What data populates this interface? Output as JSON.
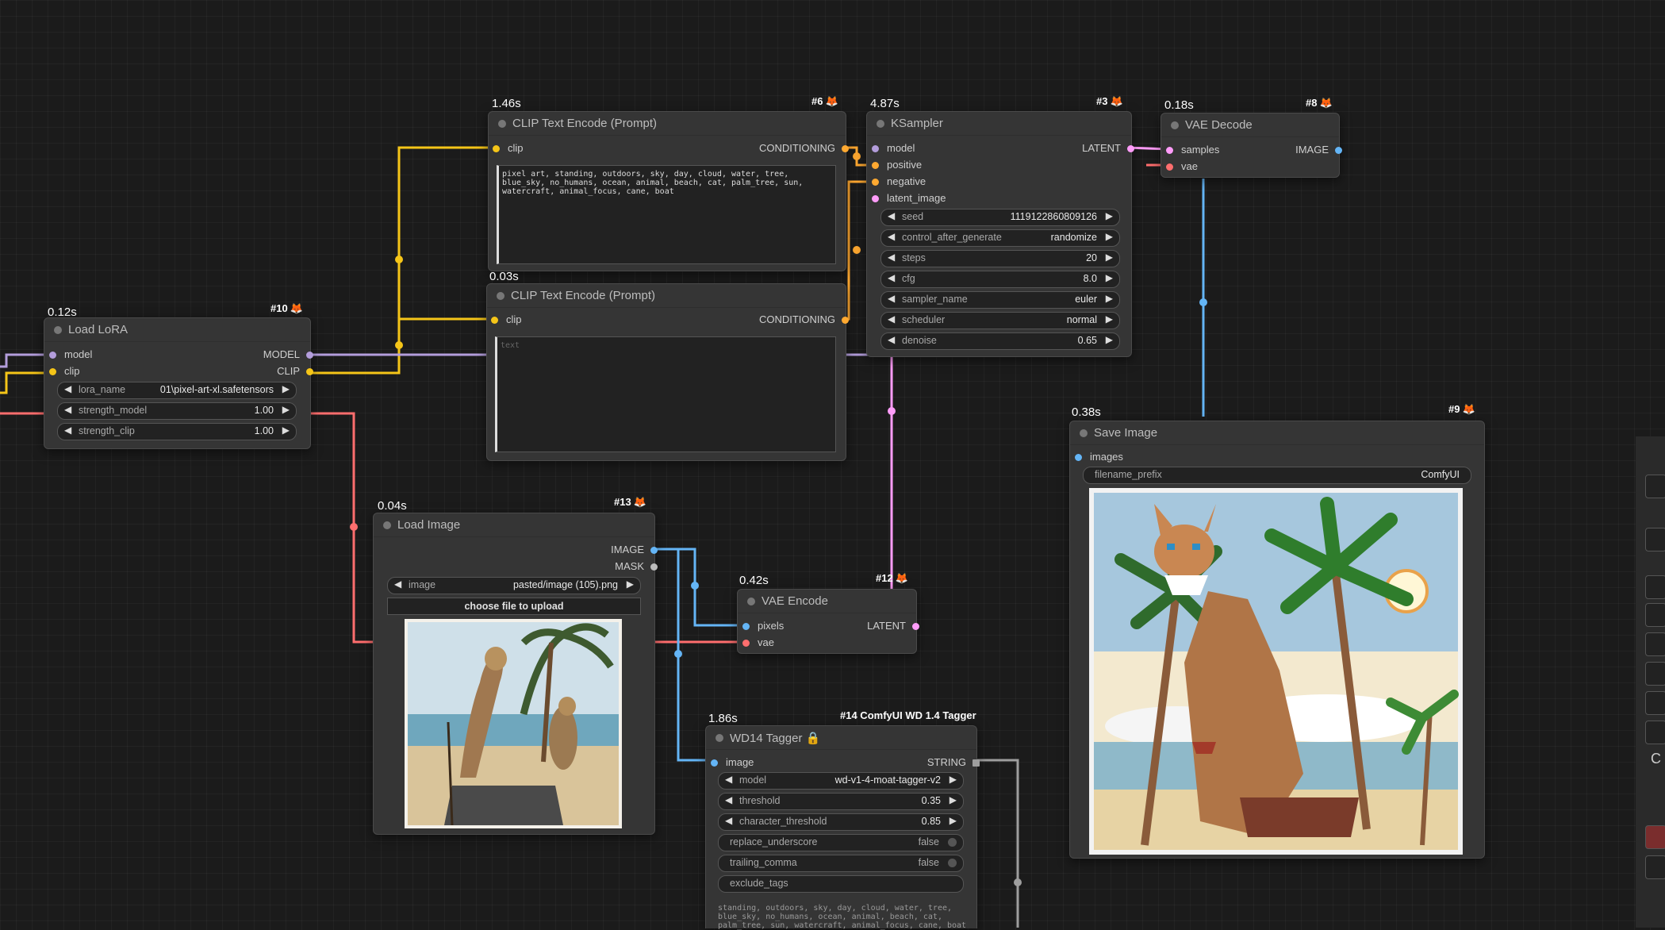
{
  "colors": {
    "clip": "#f5c518",
    "model": "#b39ddb",
    "conditioning": "#ffa931",
    "latent": "#ff9cf9",
    "image": "#64b5f6",
    "vae": "#ff6e6e",
    "string": "#9e9e9e"
  },
  "nodes": {
    "clip_pos": {
      "timing": "1.46s",
      "badge": "#6",
      "title": "CLIP Text Encode (Prompt)",
      "in_clip": "clip",
      "out_cond": "CONDITIONING",
      "text": "pixel art, standing, outdoors, sky, day, cloud, water, tree, blue_sky, no_humans, ocean, animal, beach, cat, palm_tree, sun, watercraft, animal_focus, cane, boat"
    },
    "clip_neg": {
      "timing": "0.03s",
      "title": "CLIP Text Encode (Prompt)",
      "in_clip": "clip",
      "out_cond": "CONDITIONING",
      "placeholder": "text"
    },
    "ksampler": {
      "timing": "4.87s",
      "badge": "#3",
      "title": "KSampler",
      "in_model": "model",
      "in_positive": "positive",
      "in_negative": "negative",
      "in_latent": "latent_image",
      "out_latent": "LATENT",
      "widgets": [
        {
          "label": "seed",
          "value": "1119122860809126"
        },
        {
          "label": "control_after_generate",
          "value": "randomize"
        },
        {
          "label": "steps",
          "value": "20"
        },
        {
          "label": "cfg",
          "value": "8.0"
        },
        {
          "label": "sampler_name",
          "value": "euler"
        },
        {
          "label": "scheduler",
          "value": "normal"
        },
        {
          "label": "denoise",
          "value": "0.65"
        }
      ]
    },
    "vae_decode": {
      "timing": "0.18s",
      "badge": "#8",
      "title": "VAE Decode",
      "in_samples": "samples",
      "in_vae": "vae",
      "out_image": "IMAGE"
    },
    "load_lora": {
      "timing": "0.12s",
      "badge": "#10",
      "title": "Load LoRA",
      "in_model": "model",
      "in_clip": "clip",
      "out_model": "MODEL",
      "out_clip": "CLIP",
      "widgets": [
        {
          "label": "lora_name",
          "value": "01\\pixel-art-xl.safetensors"
        },
        {
          "label": "strength_model",
          "value": "1.00"
        },
        {
          "label": "strength_clip",
          "value": "1.00"
        }
      ]
    },
    "load_image": {
      "timing": "0.04s",
      "badge": "#13",
      "title": "Load Image",
      "out_image": "IMAGE",
      "out_mask": "MASK",
      "widget_label": "image",
      "widget_value": "pasted/image (105).png",
      "upload": "choose file to upload"
    },
    "vae_encode": {
      "timing": "0.42s",
      "badge": "#12",
      "title": "VAE Encode",
      "in_pixels": "pixels",
      "in_vae": "vae",
      "out_latent": "LATENT"
    },
    "save_image": {
      "timing": "0.38s",
      "badge": "#9",
      "title": "Save Image",
      "in_images": "images",
      "widget_label": "filename_prefix",
      "widget_value": "ComfyUI"
    },
    "wd14": {
      "timing": "1.86s",
      "badge": "#14 ComfyUI WD 1.4 Tagger",
      "title": "WD14 Tagger",
      "in_image": "image",
      "out_string": "STRING",
      "widgets": [
        {
          "label": "model",
          "value": "wd-v1-4-moat-tagger-v2"
        },
        {
          "label": "threshold",
          "value": "0.35"
        },
        {
          "label": "character_threshold",
          "value": "0.85"
        }
      ],
      "toggles": [
        {
          "label": "replace_underscore",
          "value": "false"
        },
        {
          "label": "trailing_comma",
          "value": "false"
        }
      ],
      "exclude_label": "exclude_tags",
      "output_text": "standing, outdoors, sky, day, cloud, water, tree,\nblue_sky, no_humans, ocean, animal, beach, cat,\npalm_tree, sun, watercraft, animal_focus, cane, boat"
    }
  },
  "right_panel": {
    "char1": "C"
  }
}
